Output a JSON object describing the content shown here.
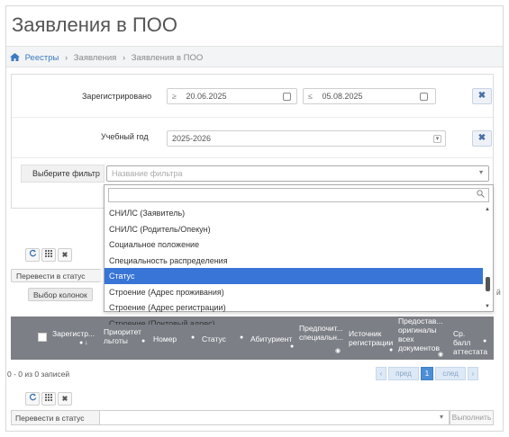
{
  "page_title": "Заявления в ПОО",
  "breadcrumb": {
    "items": [
      "Реестры",
      "Заявления",
      "Заявления в ПОО"
    ],
    "separator": "›"
  },
  "filters": {
    "registered": {
      "label": "Зарегистрировано",
      "op_from": "≥",
      "date_from": "20.06.2025",
      "op_to": "≤",
      "date_to": "05.08.2025"
    },
    "year": {
      "label": "Учебный год",
      "value": "2025-2026"
    },
    "choose": {
      "label": "Выберите фильтр",
      "placeholder": "Название фильтра"
    }
  },
  "dropdown": {
    "items": [
      "СНИЛС (Заявитель)",
      "СНИЛС (Родитель/Опекун)",
      "Социальное положение",
      "Специальность распределения",
      "Статус",
      "Строение (Адрес проживания)",
      "Строение (Адрес регистрации)",
      "Строение (Почтовый адрес)"
    ],
    "selected_index": 4
  },
  "toolbar": {
    "refresh_icon": "refresh-icon",
    "grid_icon": "grid-icon",
    "close_icon": "close-icon",
    "transfer_label": "Перевести в статус",
    "columns_label": "Выбор колонок",
    "partial_right": "й"
  },
  "table": {
    "columns": [
      "Зарегистр...",
      "Приоритет льготы",
      "Номер",
      "Статус",
      "Абитуриент",
      "Предпочит... специальн...",
      "Источник регистрации",
      "Предостав... оригиналы всех документов",
      "Ср. балл аттестата"
    ]
  },
  "records_text": "0 - 0 из 0 записей",
  "pager": {
    "prev": "пред",
    "page": "1",
    "next": "след"
  },
  "bottom_toolbar": {
    "transfer_label": "Перевести в статус",
    "execute_label": "Выполнить"
  },
  "colors": {
    "header_bg": "#7c7f86",
    "selected_bg": "#3875d7",
    "link": "#3b7bbf"
  }
}
